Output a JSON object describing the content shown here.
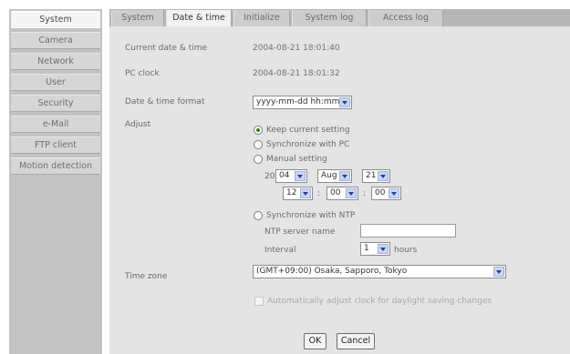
{
  "sidebar": {
    "items": [
      {
        "label": "System"
      },
      {
        "label": "Camera"
      },
      {
        "label": "Network"
      },
      {
        "label": "User"
      },
      {
        "label": "Security"
      },
      {
        "label": "e-Mail"
      },
      {
        "label": "FTP client"
      },
      {
        "label": "Motion detection"
      }
    ],
    "active": "System"
  },
  "tabs": [
    {
      "label": "System"
    },
    {
      "label": "Date & time"
    },
    {
      "label": "Initialize"
    },
    {
      "label": "System log"
    },
    {
      "label": "Access log"
    }
  ],
  "active_tab": "Date & time",
  "form": {
    "current_label": "Current date & time",
    "current_value": "2004-08-21  18:01:40",
    "pc_label": "PC clock",
    "pc_value": "2004-08-21  18:01:32",
    "format_label": "Date & time format",
    "format_value": "yyyy-mm-dd hh:mm:ss",
    "adjust_label": "Adjust",
    "keep_label": "Keep current setting",
    "sync_pc_label": "Synchronize with PC",
    "manual_label": "Manual setting",
    "year_prefix": "20",
    "year_value": "04",
    "month_value": "Aug",
    "day_value": "21",
    "hour_value": "12",
    "minute_value": "00",
    "second_value": "00",
    "colon": ":",
    "sync_ntp_label": "Synchronize with NTP",
    "ntp_server_label": "NTP server name",
    "ntp_server_value": "",
    "interval_label": "Interval",
    "interval_value": "1",
    "interval_unit": "hours",
    "timezone_label": "Time zone",
    "timezone_value": "(GMT+09:00) Osaka, Sapporo, Tokyo",
    "dst_label": "Automatically adjust clock for daylight saving changes",
    "ok_label": "OK",
    "cancel_label": "Cancel"
  },
  "colors": {
    "sidebar_bg": "#c3c3c3",
    "content_bg": "#e4e4e4",
    "select_arrow": "#c9d6f2"
  }
}
